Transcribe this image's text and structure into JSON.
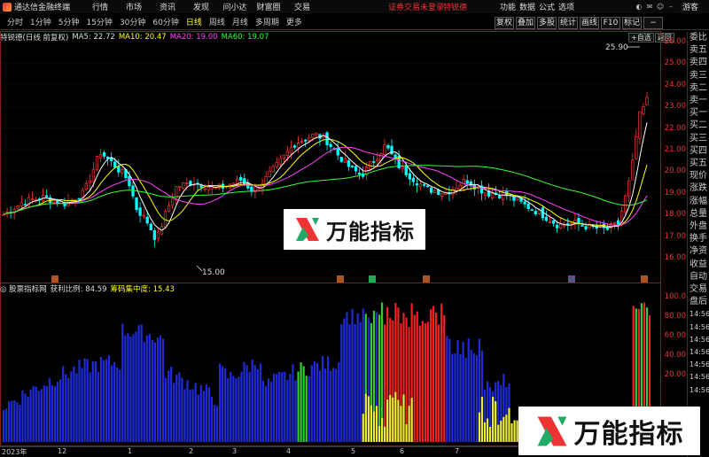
{
  "titlebar": {
    "app_name": "通达信金融终端",
    "menu": [
      "行情",
      "市场",
      "资讯",
      "发现",
      "问小达",
      "财富圈",
      "交易"
    ],
    "warning": "证券交易未登录",
    "account": "特锐德",
    "right_menu": [
      "功能",
      "数据",
      "公式",
      "选项"
    ],
    "guest": "游客"
  },
  "periods": [
    "分时",
    "1分钟",
    "5分钟",
    "15分钟",
    "30分钟",
    "60分钟",
    "日线",
    "周线",
    "月线",
    "多周期",
    "更多"
  ],
  "active_period": "日线",
  "tools": [
    "复权",
    "叠加",
    "多股",
    "统计",
    "画线",
    "F10",
    "标记",
    "−"
  ],
  "top_buttons": [
    "+自选",
    "返回"
  ],
  "ma_info": {
    "name": "特锐德(日线 前复权)",
    "ma5": "MA5: 22.72",
    "ma10": "MA10: 20.47",
    "ma20": "MA20: 19.00",
    "ma60": "MA60: 19.07"
  },
  "price_axis": [
    "26.00",
    "25.00",
    "24.00",
    "23.00",
    "22.00",
    "21.00",
    "20.00",
    "19.00",
    "18.00",
    "17.00",
    "16.00"
  ],
  "price_labels": {
    "high": "25.90",
    "low": "15.00"
  },
  "indicator_info": {
    "name": "◎ 股票指标网",
    "profit": "获利比例: 84.59",
    "concentration": "筹码集中度: 15.43"
  },
  "indicator_axis": [
    "100.0",
    "80.00",
    "60.00",
    "40.00",
    "20.00"
  ],
  "bottom_dates": [
    "2023年",
    "12",
    "1",
    "2",
    "3",
    "4",
    "5",
    "6",
    "7"
  ],
  "side_panel": [
    "委比",
    "卖五",
    "卖四",
    "卖三",
    "卖二",
    "卖一",
    "买一",
    "买二",
    "买三",
    "买四",
    "买五",
    "现价",
    "涨跌",
    "涨幅",
    "总量",
    "外盘",
    "换手",
    "净资",
    "收益",
    "",
    "自动",
    "交易",
    "盘后",
    "14:56",
    "14:56",
    "14:56",
    "14:56",
    "14:56",
    "14:56",
    "14:56"
  ],
  "watermark_text": "万能指标",
  "colors": {
    "up": "#ff3333",
    "down": "#00ffff",
    "ma5": "#ffffff",
    "ma10": "#ffff00",
    "ma20": "#ff44ff",
    "ma60": "#33ff33"
  }
}
